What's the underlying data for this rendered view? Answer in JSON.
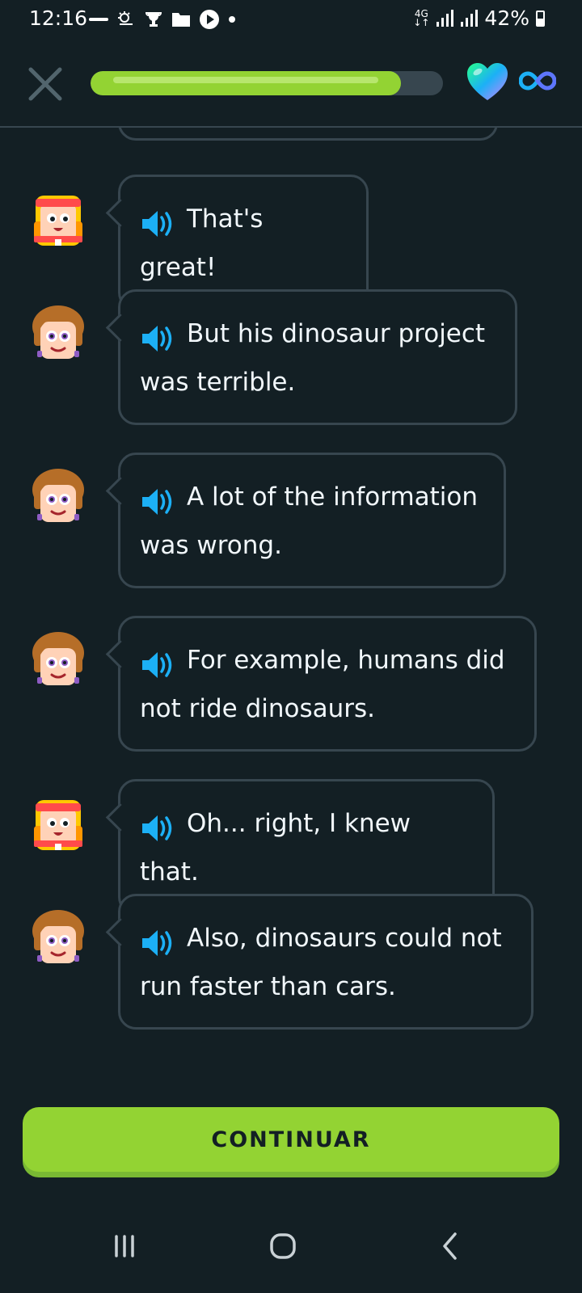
{
  "status_bar": {
    "time": "12:16",
    "network": "4G",
    "battery": "42%"
  },
  "header": {
    "progress_fraction": 0.88,
    "accent_color": "#93d333",
    "hearts": "infinite"
  },
  "messages": [
    {
      "speaker": "girl",
      "lines": [
        "That's great!"
      ]
    },
    {
      "speaker": "boy",
      "lines": [
        "But his dinosaur project",
        "was terrible."
      ]
    },
    {
      "speaker": "boy",
      "lines": [
        "A lot of the information",
        "was wrong."
      ]
    },
    {
      "speaker": "boy",
      "lines": [
        "For example, humans did",
        "not ride dinosaurs."
      ]
    },
    {
      "speaker": "girl",
      "lines": [
        "Oh... right, I knew that."
      ]
    },
    {
      "speaker": "boy",
      "lines": [
        "Also, dinosaurs could not",
        "run faster than cars."
      ]
    }
  ],
  "continue_button": {
    "label": "CONTINUAR"
  }
}
